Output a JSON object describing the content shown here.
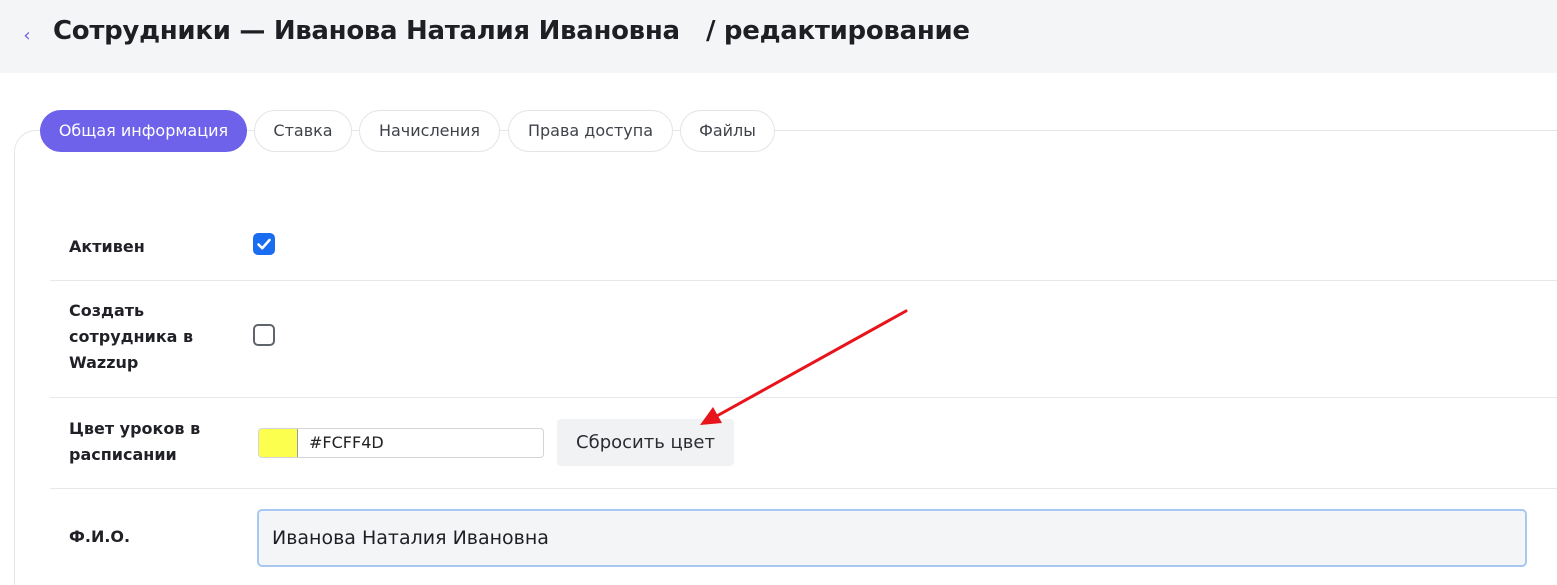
{
  "header": {
    "title": "Сотрудники — Иванова Наталия Ивановна   / редактирование",
    "back_icon": "chevron-left-icon",
    "back_glyph": "‹"
  },
  "tabs": [
    {
      "label": "Общая информация",
      "active": true
    },
    {
      "label": "Ставка",
      "active": false
    },
    {
      "label": "Начисления",
      "active": false
    },
    {
      "label": "Права доступа",
      "active": false
    },
    {
      "label": "Файлы",
      "active": false
    }
  ],
  "form": {
    "active": {
      "label": "Активен",
      "checked": true
    },
    "wazzup": {
      "label": "Создать сотрудника в Wazzup",
      "checked": false
    },
    "lesson_color": {
      "label": "Цвет уроков в расписании",
      "value": "#FCFF4D",
      "reset_label": "Сбросить цвет"
    },
    "full_name": {
      "label": "Ф.И.О.",
      "value": "Иванова Наталия Ивановна"
    }
  },
  "annotation": {
    "icon": "red-arrow-icon",
    "color": "#e8141c"
  },
  "colors": {
    "accent": "#6e62ea",
    "checkbox": "#1a6cf0",
    "swatch": "#FCFF4D"
  }
}
